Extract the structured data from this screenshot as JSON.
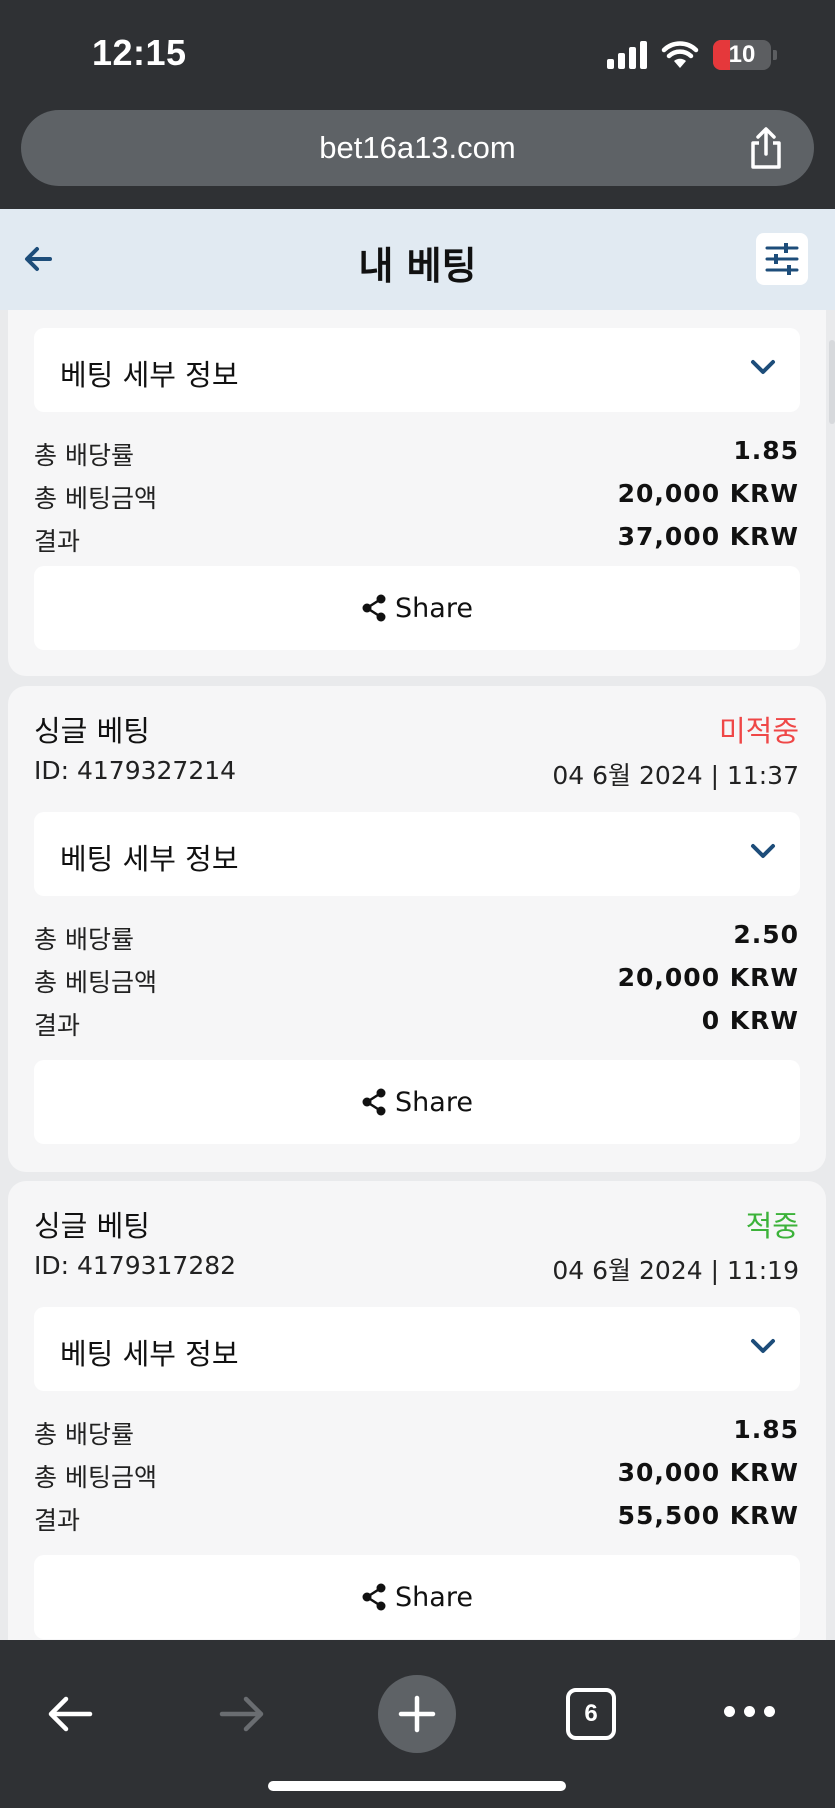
{
  "status_bar": {
    "time": "12:15",
    "battery_level": "10",
    "battery_fraction": 0.1,
    "icons": [
      "signal-icon",
      "wifi-icon",
      "battery-icon"
    ]
  },
  "browser": {
    "url": "bet16a13.com",
    "tab_count": "6"
  },
  "header": {
    "title": "내 베팅"
  },
  "colors": {
    "lost": "#ef4747",
    "won": "#3cb23a",
    "accent": "#1d4d7a"
  },
  "bets": [
    {
      "details_label": "베팅 세부 정보",
      "rows": [
        {
          "label": "총 배당률",
          "value": "1.85"
        },
        {
          "label": "총 베팅금액",
          "value": "20,000 KRW"
        },
        {
          "label": "결과",
          "value": "37,000 KRW"
        }
      ],
      "share_label": "Share"
    },
    {
      "title": "싱글 베팅",
      "status": "미적중",
      "id": "ID: 4179327214",
      "date": "04 6월 2024 | 11:37",
      "details_label": "베팅 세부 정보",
      "rows": [
        {
          "label": "총 배당률",
          "value": "2.50"
        },
        {
          "label": "총 베팅금액",
          "value": "20,000 KRW"
        },
        {
          "label": "결과",
          "value": "0 KRW"
        }
      ],
      "share_label": "Share"
    },
    {
      "title": "싱글 베팅",
      "status": "적중",
      "id": "ID: 4179317282",
      "date": "04 6월 2024 | 11:19",
      "details_label": "베팅 세부 정보",
      "rows": [
        {
          "label": "총 배당률",
          "value": "1.85"
        },
        {
          "label": "총 베팅금액",
          "value": "30,000 KRW"
        },
        {
          "label": "결과",
          "value": "55,500 KRW"
        }
      ],
      "share_label": "Share"
    }
  ]
}
